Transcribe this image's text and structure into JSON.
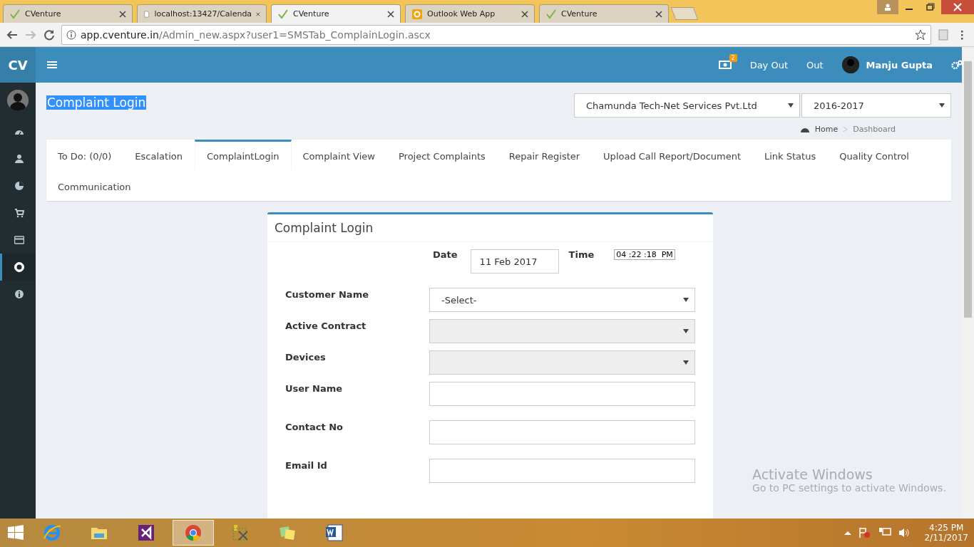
{
  "browser": {
    "tabs": [
      {
        "title": "CVenture",
        "selected": false
      },
      {
        "title": "localhost:13427/Calenda",
        "selected": false
      },
      {
        "title": "CVenture",
        "selected": true
      },
      {
        "title": "Outlook Web App",
        "selected": false
      },
      {
        "title": "CVenture",
        "selected": false
      }
    ],
    "url_host": "app.cventure.in",
    "url_path": "/Admin_new.aspx?user1=SMSTab_ComplainLogin.ascx"
  },
  "header": {
    "logo": "CV",
    "notification_count": "2",
    "links": [
      "Day Out",
      "Out"
    ],
    "user_name": "Manju Gupta"
  },
  "sidebar": {
    "items": [
      {
        "selected": false
      },
      {
        "selected": false
      },
      {
        "selected": false
      },
      {
        "selected": false
      },
      {
        "selected": false
      },
      {
        "selected": true
      },
      {
        "selected": false
      }
    ]
  },
  "page": {
    "title": "Complaint Login",
    "company": "Chamunda Tech-Net Services Pvt.Ltd",
    "year": "2016-2017",
    "breadcrumb": [
      "Home",
      "Dashboard"
    ]
  },
  "tabs": [
    {
      "label": "To Do: (0/0)",
      "selected": false
    },
    {
      "label": "Escalation",
      "selected": false
    },
    {
      "label": "ComplaintLogin",
      "selected": true
    },
    {
      "label": "Complaint View",
      "selected": false
    },
    {
      "label": "Project Complaints",
      "selected": false
    },
    {
      "label": "Repair Register",
      "selected": false
    },
    {
      "label": "Upload Call Report/Document",
      "selected": false
    },
    {
      "label": "Link Status",
      "selected": false
    },
    {
      "label": "Quality Control",
      "selected": false
    },
    {
      "label": "Communication",
      "selected": false
    }
  ],
  "form": {
    "title": "Complaint Login",
    "date_label": "Date",
    "date_value": "11 Feb 2017",
    "time_label": "Time",
    "time_value": "04 :22 :18  PM",
    "fields": [
      {
        "label": "Customer Name",
        "kind": "select",
        "value": "-Select-",
        "disabled": false
      },
      {
        "label": "Active Contract",
        "kind": "select",
        "disabled": true
      },
      {
        "label": "Devices",
        "kind": "select",
        "disabled": true
      },
      {
        "label": "User Name",
        "kind": "text"
      },
      {
        "label": "Contact No",
        "kind": "text"
      },
      {
        "label": "Email Id",
        "kind": "text"
      }
    ]
  },
  "activation": {
    "title": "Activate Windows",
    "message": "Go to PC settings to activate Windows."
  },
  "taskbar": {
    "apps": [
      {
        "selected": false
      },
      {
        "selected": false
      },
      {
        "selected": false
      },
      {
        "selected": true
      },
      {
        "selected": false
      },
      {
        "selected": false
      },
      {
        "selected": false
      }
    ],
    "time": "4:25 PM",
    "date": "2/11/2017"
  }
}
